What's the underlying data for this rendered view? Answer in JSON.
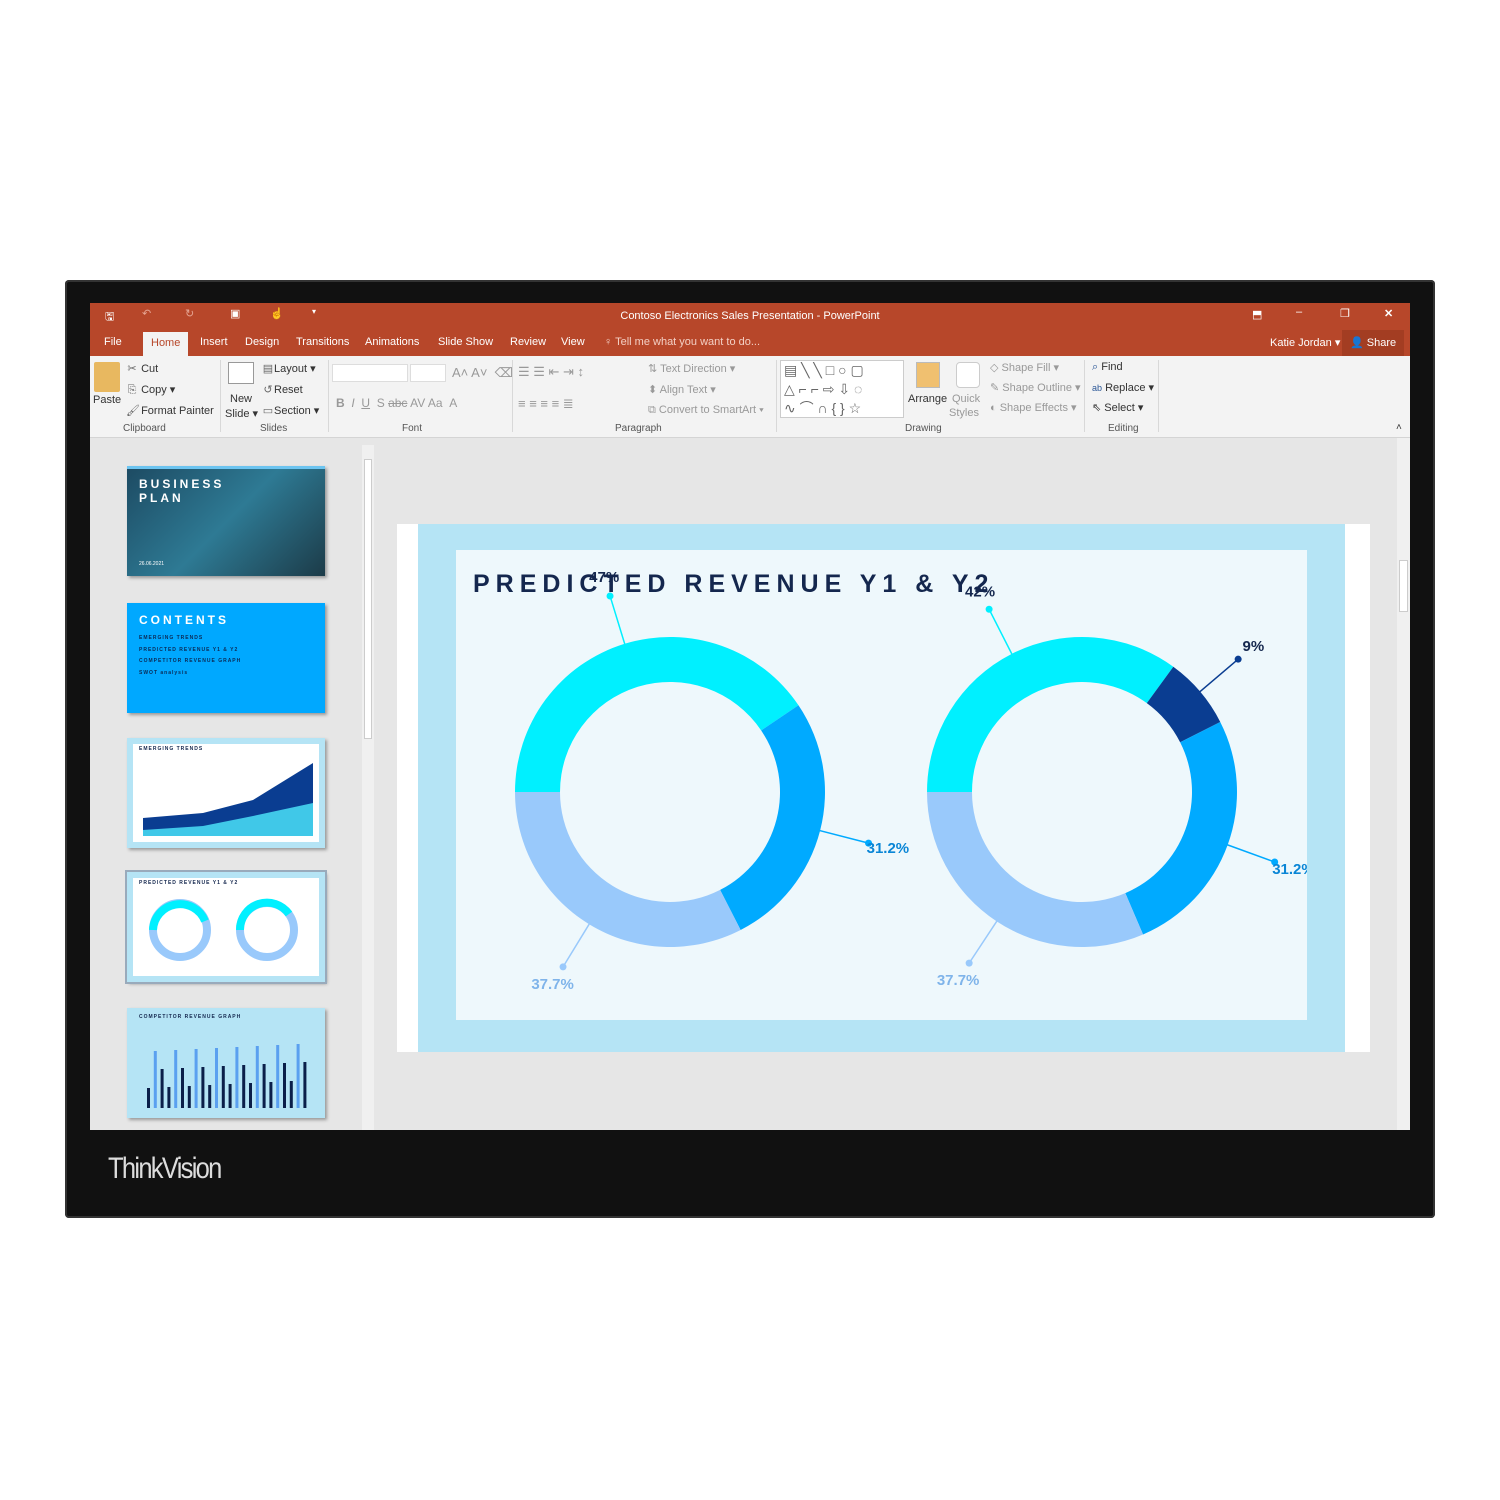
{
  "window": {
    "title": "Contoso Electronics Sales Presentation - PowerPoint",
    "user": "Katie Jordan",
    "share": "Share"
  },
  "tabs": [
    "File",
    "Home",
    "Insert",
    "Design",
    "Transitions",
    "Animations",
    "Slide Show",
    "Review",
    "View"
  ],
  "tell_me": "Tell me what you want to do...",
  "ribbon": {
    "clipboard": {
      "paste": "Paste",
      "cut": "Cut",
      "copy": "Copy",
      "format_painter": "Format Painter",
      "label": "Clipboard"
    },
    "slides": {
      "new": "New",
      "slide": "Slide",
      "layout": "Layout",
      "reset": "Reset",
      "section": "Section",
      "label": "Slides"
    },
    "font": {
      "label": "Font",
      "bold": "B",
      "italic": "I",
      "underline": "U",
      "shadow": "S",
      "strike": "abc",
      "spacing": "AV",
      "case": "Aa",
      "color": "A"
    },
    "paragraph": {
      "text_direction": "Text Direction",
      "align_text": "Align Text",
      "smartart": "Convert to SmartArt",
      "label": "Paragraph"
    },
    "drawing": {
      "arrange": "Arrange",
      "quick": "Quick",
      "styles": "Styles",
      "fill": "Shape Fill",
      "outline": "Shape Outline",
      "effects": "Shape Effects",
      "label": "Drawing"
    },
    "editing": {
      "find": "Find",
      "replace": "Replace",
      "select": "Select",
      "label": "Editing"
    }
  },
  "thumbnails": [
    {
      "title": "BUSINESS PLAN",
      "sub": "26.06.2021"
    },
    {
      "title": "CONTENTS",
      "items": [
        "EMERGING TRENDS",
        "PREDICTED REVENUE Y1 & Y2",
        "COMPETITOR REVENUE GRAPH",
        "SWOT analysis"
      ]
    },
    {
      "title": "EMERGING TRENDS"
    },
    {
      "title": "PREDICTED REVENUE Y1 & Y2"
    },
    {
      "title": "COMPETITOR REVENUE GRAPH"
    }
  ],
  "brand": "ThinkVision",
  "chart_data": {
    "type": "pie",
    "title": "PREDICTED REVENUE Y1 & Y2",
    "charts": [
      {
        "segments": [
          {
            "label": "47%",
            "value": 47,
            "color": "#00f0ff"
          },
          {
            "label": "31.2%",
            "value": 31.2,
            "color": "#00aaff"
          },
          {
            "label": "37.7%",
            "value": 37.7,
            "color": "#99c9fb"
          }
        ]
      },
      {
        "segments": [
          {
            "label": "42%",
            "value": 42,
            "color": "#00f0ff"
          },
          {
            "label": "9%",
            "value": 9,
            "color": "#0a3d91"
          },
          {
            "label": "31.2%",
            "value": 31.2,
            "color": "#00aaff"
          },
          {
            "label": "37.7%",
            "value": 37.7,
            "color": "#99c9fb"
          }
        ]
      }
    ]
  }
}
